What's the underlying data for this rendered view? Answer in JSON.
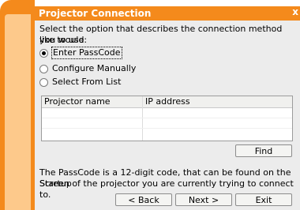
{
  "window": {
    "title": "Projector Connection",
    "close_glyph": "x"
  },
  "prompt": {
    "line1": "Select the option that describes the connection method you would",
    "line2": "like to use:"
  },
  "options": [
    {
      "label": "Enter PassCode",
      "selected": true
    },
    {
      "label": "Configure Manually",
      "selected": false
    },
    {
      "label": "Select From List",
      "selected": false
    }
  ],
  "table": {
    "columns": [
      "Projector name",
      "IP address"
    ],
    "rows": []
  },
  "buttons": {
    "find": "Find",
    "back": "< Back",
    "next": "Next >",
    "exit": "Exit"
  },
  "info": {
    "line1": "The PassCode is a 12-digit code, that can be found on the Startup",
    "line2": "Screen of the projector you are currently trying to connect to."
  },
  "colors": {
    "accent": "#f48a1c",
    "accent_light": "#fdc98b",
    "panel": "#ececec"
  }
}
